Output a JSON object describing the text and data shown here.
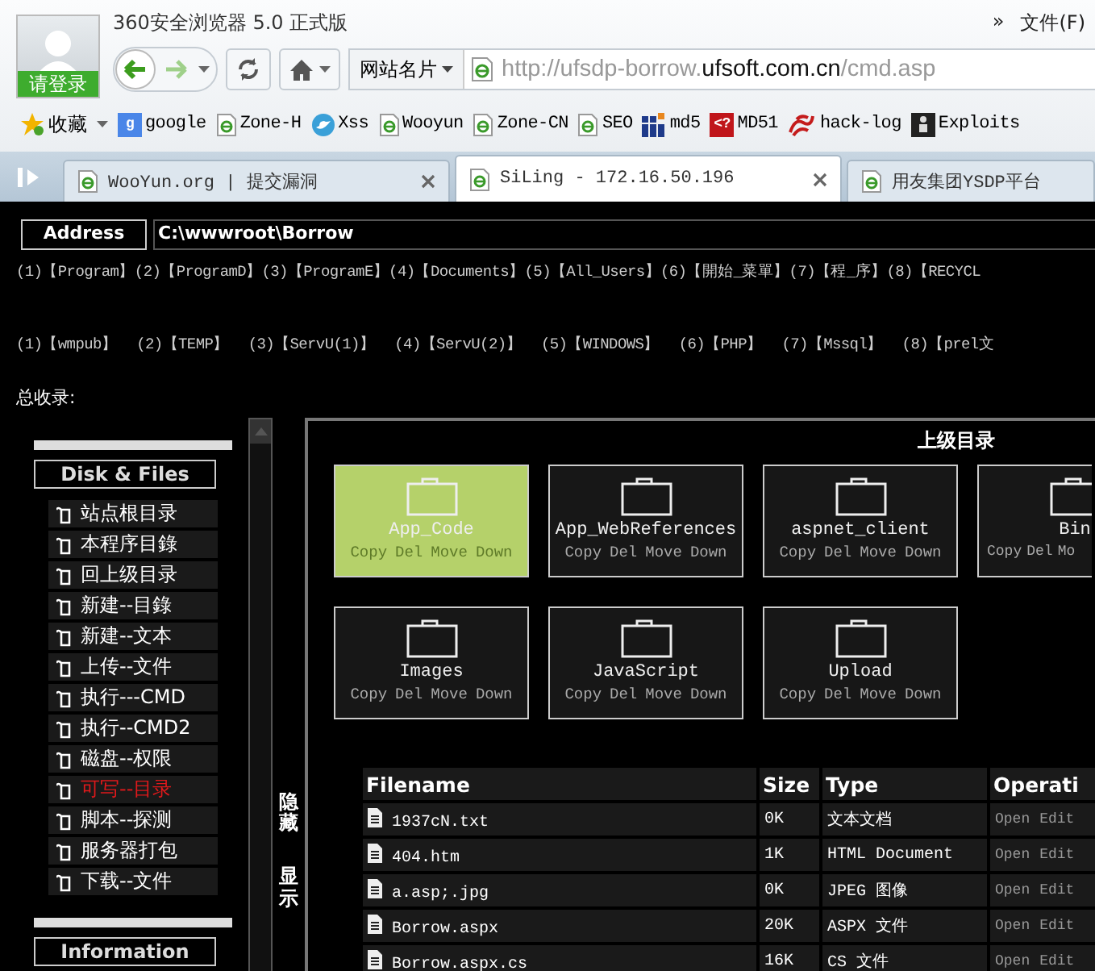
{
  "browser": {
    "title": "360安全浏览器 5.0 正式版",
    "login_label": "请登录",
    "menu": [
      "»",
      "文件(F)"
    ],
    "site_card": "网站名片",
    "url": {
      "prefix": "http://ufsdp-borrow.",
      "domain": "ufsoft.com.cn",
      "path": "/cmd.asp"
    },
    "favorites_label": "收藏",
    "bookmarks": [
      {
        "label": "google",
        "kind": "badge",
        "badge": "g",
        "color": "#4a86e8"
      },
      {
        "label": "Zone-H",
        "kind": "page"
      },
      {
        "label": "Xss",
        "kind": "bird"
      },
      {
        "label": "Wooyun",
        "kind": "page"
      },
      {
        "label": "Zone-CN",
        "kind": "page"
      },
      {
        "label": "SEO",
        "kind": "page"
      },
      {
        "label": "md5",
        "kind": "grid"
      },
      {
        "label": "MD51",
        "kind": "badge",
        "badge": "<?",
        "color": "#c0161b"
      },
      {
        "label": "hack-log",
        "kind": "emblem"
      },
      {
        "label": "Exploits",
        "kind": "figure"
      }
    ],
    "tabs": [
      {
        "label": "WooYun.org | 提交漏洞",
        "selected": false,
        "closable": true
      },
      {
        "label": "SiLing - 172.16.50.196",
        "selected": true,
        "closable": true
      },
      {
        "label": "用友集团YSDP平台",
        "selected": false,
        "closable": false
      }
    ]
  },
  "page": {
    "address_label": "Address",
    "address_value": "C:\\wwwroot\\Borrow",
    "drive_rows": [
      [
        "(1)【Program】",
        "(2)【ProgramD】",
        "(3)【ProgramE】",
        "(4)【Documents】",
        "(5)【All_Users】",
        "(6)【開始_菜單】",
        "(7)【程_序】",
        "(8)【RECYCL"
      ],
      [
        "(1)【wmpub】",
        "(2)【TEMP】",
        "(3)【ServU(1)】",
        "(4)【ServU(2)】",
        "(5)【WINDOWS】",
        "(6)【PHP】",
        "(7)【Mssql】",
        "(8)【prel文"
      ]
    ],
    "total_label": "总收录:",
    "sidebar": [
      {
        "title": "Disk & Files",
        "items": [
          {
            "label": "站点根目录",
            "highlighted": false
          },
          {
            "label": "本程序目錄",
            "highlighted": false
          },
          {
            "label": "回上级目录",
            "highlighted": false
          },
          {
            "label": "新建--目錄",
            "highlighted": false
          },
          {
            "label": "新建--文本",
            "highlighted": false
          },
          {
            "label": "上传--文件",
            "highlighted": false
          },
          {
            "label": "执行---CMD",
            "highlighted": false
          },
          {
            "label": "执行--CMD2",
            "highlighted": false
          },
          {
            "label": "磁盘--权限",
            "highlighted": false
          },
          {
            "label": "可写--目录",
            "highlighted": true
          },
          {
            "label": "脚本--探测",
            "highlighted": false
          },
          {
            "label": "服务器打包",
            "highlighted": false
          },
          {
            "label": "下载--文件",
            "highlighted": false
          }
        ]
      },
      {
        "title": "Information"
      }
    ],
    "toggles": [
      "隐藏",
      "显示"
    ],
    "parent_dir": "上级目录",
    "folders": [
      {
        "name": "App_Code",
        "selected": true,
        "actions": [
          "Copy",
          "Del",
          "Move",
          "Down"
        ]
      },
      {
        "name": "App_WebReferences",
        "selected": false,
        "actions": [
          "Copy",
          "Del",
          "Move",
          "Down"
        ]
      },
      {
        "name": "aspnet_client",
        "selected": false,
        "actions": [
          "Copy",
          "Del",
          "Move",
          "Down"
        ]
      },
      {
        "name": "Bin",
        "selected": false,
        "actions": [
          "Copy",
          "Del",
          "Mo"
        ]
      },
      {
        "name": "Images",
        "selected": false,
        "actions": [
          "Copy",
          "Del",
          "Move",
          "Down"
        ]
      },
      {
        "name": "JavaScript",
        "selected": false,
        "actions": [
          "Copy",
          "Del",
          "Move",
          "Down"
        ]
      },
      {
        "name": "Upload",
        "selected": false,
        "actions": [
          "Copy",
          "Del",
          "Move",
          "Down"
        ]
      }
    ],
    "table": {
      "columns": [
        "Filename",
        "Size",
        "Type",
        "Operati"
      ],
      "rows": [
        {
          "filename": "1937cN.txt",
          "size": "0K",
          "type": "文本文档",
          "ops": [
            "Open",
            "Edit"
          ]
        },
        {
          "filename": "404.htm",
          "size": "1K",
          "type": "HTML Document",
          "ops": [
            "Open",
            "Edit"
          ]
        },
        {
          "filename": "a.asp;.jpg",
          "size": "0K",
          "type": "JPEG 图像",
          "ops": [
            "Open",
            "Edit"
          ]
        },
        {
          "filename": "Borrow.aspx",
          "size": "20K",
          "type": "ASPX 文件",
          "ops": [
            "Open",
            "Edit"
          ]
        },
        {
          "filename": "Borrow.aspx.cs",
          "size": "16K",
          "type": "CS 文件",
          "ops": [
            "Open",
            "Edit"
          ]
        }
      ]
    }
  }
}
